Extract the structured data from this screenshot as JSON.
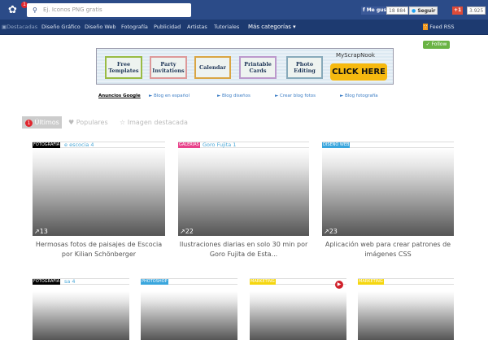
{
  "header": {
    "notif_count": "1",
    "search_placeholder": "Ej. Iconos PNG gratis",
    "like_label": "Me gusta",
    "like_count": "18 884",
    "follow_label": "Seguir",
    "gplus_label": "+1",
    "gplus_count": "3.925"
  },
  "nav": {
    "items": [
      "Destacadas",
      "Diseño Gráfico",
      "Diseño Web",
      "Fotografía",
      "Publicidad",
      "Artistas",
      "Tutoriales",
      "Más categorías"
    ],
    "feed": "Feed RSS"
  },
  "follow_button": "Follow",
  "ad": {
    "boxes": [
      "Free Templates",
      "Party Invitations",
      "Calendar",
      "Printable Cards",
      "Photo Editing"
    ],
    "brand": "MyScrapNook",
    "cta": "CLICK HERE"
  },
  "ad_links": {
    "label": "Anuncios Google",
    "items": [
      "Blog en español",
      "Blog diseños",
      "Crear blog fotos",
      "Blog fotografía"
    ]
  },
  "tabs": {
    "latest": "Últimos",
    "latest_count": "1",
    "popular": "Populares",
    "featured": "Imagen destacada"
  },
  "posts": [
    {
      "tag": "FOTOGRAFÍA",
      "tag_color": "#000000",
      "title_snip": "e escocia 4",
      "shares": "13",
      "caption": "Hermosas fotos de paisajes de Escocia por Kilian Schönberger"
    },
    {
      "tag": "GALERÍAS",
      "tag_color": "#e8418a",
      "title_snip": "Goro Fujita 1",
      "shares": "22",
      "caption": "Ilustraciones diarias en solo 30 min por Goro Fujita de Esta..."
    },
    {
      "tag": "DISEÑO WEB",
      "tag_color": "#3aa6dd",
      "title_snip": "",
      "shares": "23",
      "caption": "Aplicación web para crear patrones de imágenes CSS"
    }
  ],
  "posts2": [
    {
      "tag": "FOTOGRAFÍA",
      "tag_color": "#000000",
      "title_snip": "sa 4"
    },
    {
      "tag": "PHOTOSHOP",
      "tag_color": "#3aa6dd",
      "title_snip": ""
    },
    {
      "tag": "MARKETING",
      "tag_color": "#f5d60f",
      "title_snip": ""
    },
    {
      "tag": "MARKETING",
      "tag_color": "#f5d60f",
      "title_snip": ""
    }
  ]
}
